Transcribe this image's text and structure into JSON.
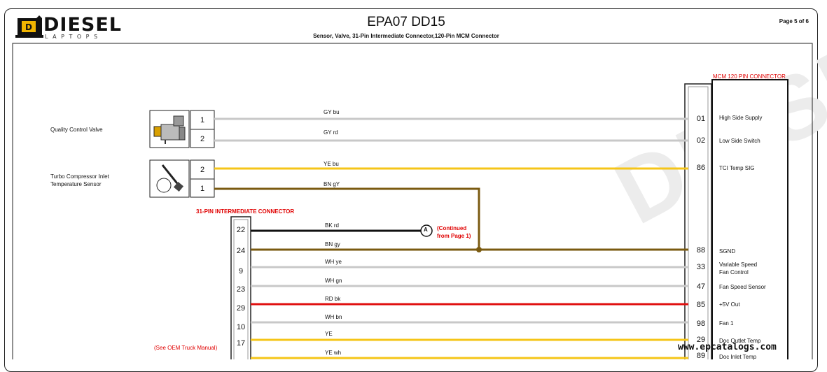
{
  "header": {
    "logo_word": "DIESEL",
    "logo_sub": "LAPTOPS",
    "title": "EPA07 DD15",
    "subtitle": "Sensor, Valve, 31-Pin Intermediate Connector,120-Pin MCM Connector",
    "page": "Page 5 of 6"
  },
  "components": {
    "qcv_label": "Quality Control Valve",
    "qcv_pins": [
      "1",
      "2"
    ],
    "tci_label_line1": "Turbo Compressor Inlet",
    "tci_label_line2": "Temperature Sensor",
    "tci_pins": [
      "2",
      "1"
    ]
  },
  "intermediate_connector": {
    "title": "31-PIN INTERMEDIATE CONNECTOR",
    "pins": [
      "22",
      "24",
      "9",
      "23",
      "29",
      "10",
      "17"
    ],
    "note": "(See OEM Truck Manual)"
  },
  "mcm_connector": {
    "title": "MCM 120 PIN CONNECTOR",
    "pins": [
      "01",
      "02",
      "86",
      "88",
      "33",
      "47",
      "85",
      "98",
      "29",
      "89"
    ],
    "labels": {
      "p01": "High Side Supply",
      "p02": "Low Side Switch",
      "p86": "TCI Temp SIG",
      "p88": "SGND",
      "p33_line1": "Variable Speed",
      "p33_line2": "Fan Control",
      "p47": "Fan Speed Sensor",
      "p85": "+5V Out",
      "p98": "Fan 1",
      "p29": "Doc Outlet Temp",
      "p89": "Doc Inlet Temp"
    }
  },
  "wires": {
    "w1": "GY bu",
    "w2": "GY rd",
    "w3": "YE bu",
    "w4": "BN gY",
    "w5": "BK rd",
    "w6": "BN gy",
    "w7": "WH ye",
    "w8": "WH gn",
    "w9": "RD bk",
    "w10": "WH bn",
    "w11": "YE",
    "w12": "YE wh"
  },
  "continuation": {
    "marker": "A",
    "line1": "(Continued",
    "line2": "from Page 1)"
  },
  "colors": {
    "gray_wire": "#c8c8c8",
    "yellow_wire": "#f5c518",
    "brown_wire": "#7a5a10",
    "black_wire": "#111111",
    "red_wire": "#e01010",
    "red_text": "#e00000"
  },
  "watermark": "DIESEL",
  "footer_url": "www.epcatalogs.com"
}
